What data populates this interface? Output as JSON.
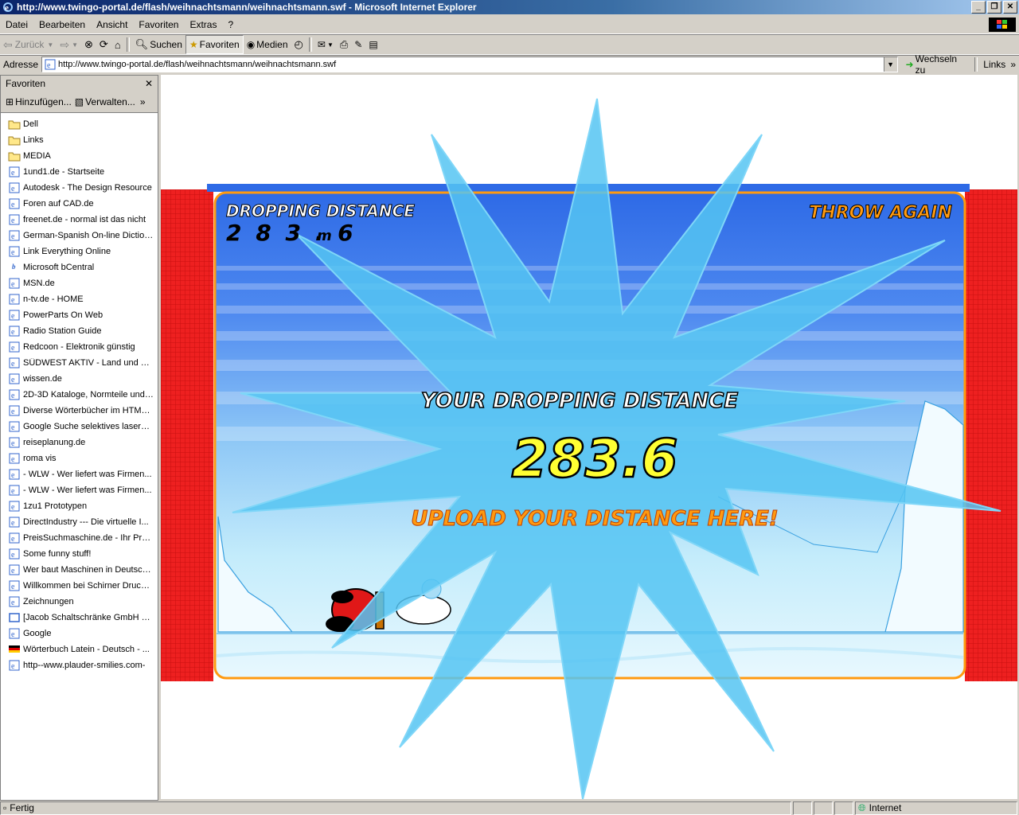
{
  "window": {
    "title": "http://www.twingo-portal.de/flash/weihnachtsmann/weihnachtsmann.swf - Microsoft Internet Explorer"
  },
  "menu": [
    "Datei",
    "Bearbeiten",
    "Ansicht",
    "Favoriten",
    "Extras",
    "?"
  ],
  "toolbar": {
    "back": "Zurück",
    "search": "Suchen",
    "favorites": "Favoriten",
    "media": "Medien"
  },
  "address": {
    "label": "Adresse",
    "url": "http://www.twingo-portal.de/flash/weihnachtsmann/weihnachtsmann.swf",
    "go": "Wechseln zu",
    "links": "Links"
  },
  "favorites": {
    "title": "Favoriten",
    "add": "Hinzufügen...",
    "manage": "Verwalten...",
    "items": [
      {
        "label": "Dell",
        "icon": "folder-icon"
      },
      {
        "label": "Links",
        "icon": "folder-icon"
      },
      {
        "label": "MEDIA",
        "icon": "folder-icon"
      },
      {
        "label": "1und1.de - Startseite",
        "icon": "ie-page-icon"
      },
      {
        "label": "Autodesk - The Design Resource",
        "icon": "ie-page-icon"
      },
      {
        "label": "Foren auf CAD.de",
        "icon": "ie-page-icon"
      },
      {
        "label": "freenet.de - normal ist das nicht",
        "icon": "ie-page-icon"
      },
      {
        "label": "German-Spanish On-line Dictionary",
        "icon": "ie-page-icon"
      },
      {
        "label": "Link Everything Online",
        "icon": "ie-page-icon"
      },
      {
        "label": "Microsoft bCentral",
        "icon": "bcentral-icon"
      },
      {
        "label": "MSN.de",
        "icon": "ie-page-icon"
      },
      {
        "label": "n-tv.de - HOME",
        "icon": "ie-page-icon"
      },
      {
        "label": "PowerParts On Web",
        "icon": "ie-page-icon"
      },
      {
        "label": "Radio Station Guide",
        "icon": "ie-page-icon"
      },
      {
        "label": "Redcoon - Elektronik günstig",
        "icon": "ie-page-icon"
      },
      {
        "label": "SÜDWEST AKTIV - Land und Welt",
        "icon": "ie-page-icon"
      },
      {
        "label": "wissen.de",
        "icon": "ie-page-icon"
      },
      {
        "label": "2D-3D Kataloge, Normteile und ...",
        "icon": "ie-page-icon"
      },
      {
        "label": "Diverse Wörterbücher im HTML-...",
        "icon": "ie-page-icon"
      },
      {
        "label": "Google Suche selektives lasersi...",
        "icon": "ie-page-icon"
      },
      {
        "label": "reiseplanung.de",
        "icon": "ie-page-icon"
      },
      {
        "label": "roma vis",
        "icon": "ie-page-icon"
      },
      {
        "label": "- WLW - Wer liefert was Firmen...",
        "icon": "ie-page-icon"
      },
      {
        "label": "- WLW - Wer liefert was Firmen...",
        "icon": "ie-page-icon"
      },
      {
        "label": "1zu1 Prototypen",
        "icon": "ie-page-icon"
      },
      {
        "label": "DirectIndustry --- Die virtuelle I...",
        "icon": "ie-page-icon"
      },
      {
        "label": "PreisSuchmaschine.de - Ihr Prei...",
        "icon": "ie-page-icon"
      },
      {
        "label": "Some funny stuff!",
        "icon": "ie-page-icon"
      },
      {
        "label": "Wer baut Maschinen in Deutsch...",
        "icon": "ie-page-icon"
      },
      {
        "label": "Willkommen bei Schirner Druckg...",
        "icon": "ie-page-icon"
      },
      {
        "label": "Zeichnungen",
        "icon": "ie-page-icon"
      },
      {
        "label": "[Jacob Schaltschränke GmbH & ...",
        "icon": "frame-icon"
      },
      {
        "label": "Google",
        "icon": "ie-page-icon"
      },
      {
        "label": "Wörterbuch Latein - Deutsch - ...",
        "icon": "german-flag-icon"
      },
      {
        "label": "http--www.plauder-smilies.com-",
        "icon": "ie-page-icon"
      }
    ]
  },
  "game": {
    "dropping_label": "DROPPING DISTANCE",
    "dropping_value": "2 8 3 . 6",
    "dropping_unit": "m",
    "throw_again": "THROW AGAIN",
    "your_distance_label": "YOUR DROPPING DISTANCE",
    "your_distance_value": "283.6",
    "upload": "UPLOAD YOUR DISTANCE HERE!"
  },
  "colors": {
    "frame_red": "#ee2020",
    "sky_top": "#2e6ae6",
    "burst": "#55c4f2",
    "label_yellow": "#ffff33",
    "label_orange": "#ff9a10"
  },
  "status": {
    "text": "Fertig",
    "zone": "Internet"
  }
}
